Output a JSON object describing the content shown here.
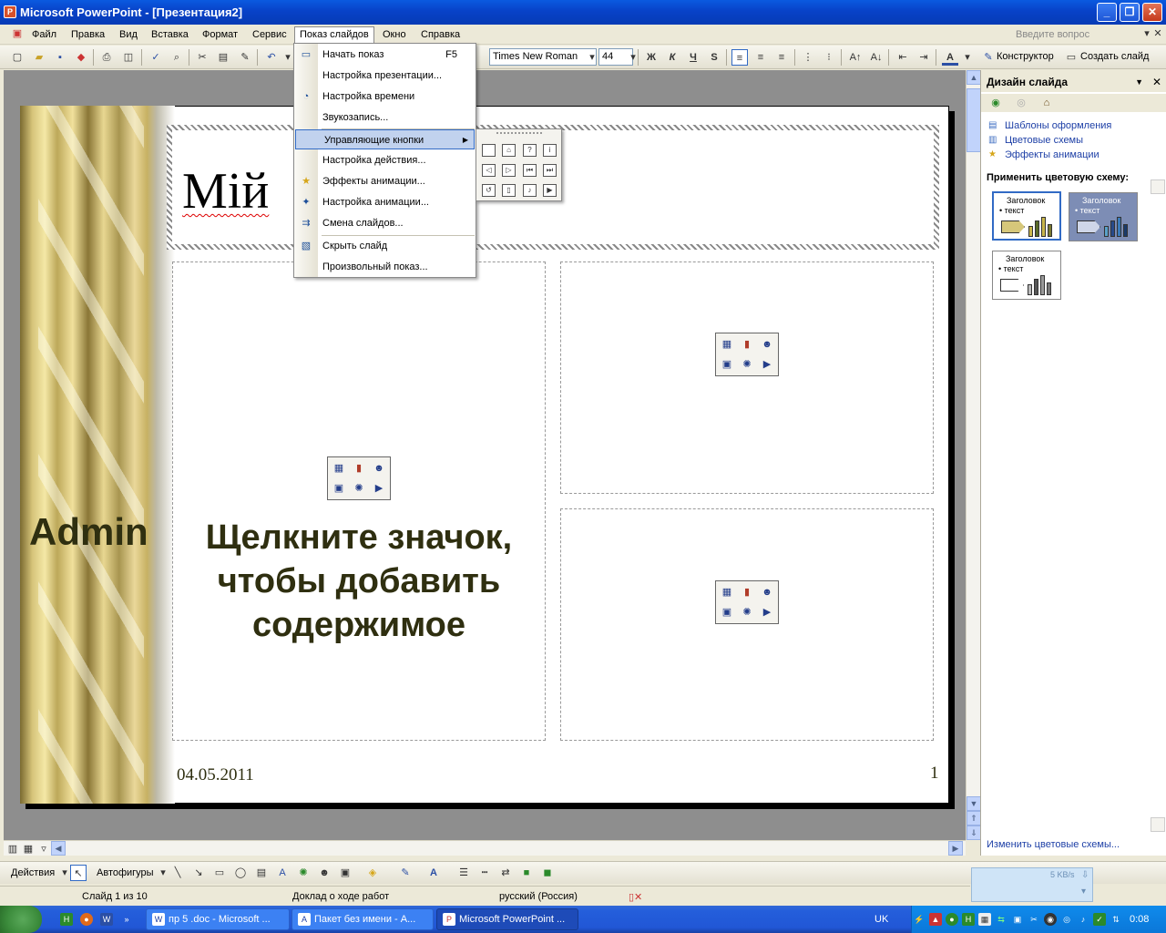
{
  "window": {
    "title": "Microsoft PowerPoint - [Презентация2]",
    "app_icon": "P",
    "minimize": "_",
    "restore": "❐",
    "close": "✕"
  },
  "menubar": {
    "items": [
      "Файл",
      "Правка",
      "Вид",
      "Вставка",
      "Формат",
      "Сервис",
      "Показ слайдов",
      "Окно",
      "Справка"
    ],
    "help_placeholder": "Введите вопрос",
    "doc_close": "✕"
  },
  "toolbar": {
    "font_name": "Times New Roman",
    "font_size": "44",
    "bold": "Ж",
    "italic": "К",
    "underline": "Ч",
    "shadow": "S",
    "designer": "Конструктор",
    "new_slide": "Создать слайд"
  },
  "dropdown": {
    "items": [
      {
        "label": "Начать показ",
        "shortcut": "F5",
        "icon": "projector-icon"
      },
      {
        "label": "Настройка презентации...",
        "shortcut": "",
        "icon": ""
      },
      {
        "label": "Настройка времени",
        "shortcut": "",
        "icon": "timing-icon"
      },
      {
        "label": "Звукозапись...",
        "shortcut": "",
        "icon": ""
      },
      {
        "label": "Управляющие кнопки",
        "shortcut": "",
        "icon": "",
        "submenu": true
      },
      {
        "label": "Настройка действия...",
        "shortcut": "",
        "icon": ""
      },
      {
        "label": "Эффекты анимации...",
        "shortcut": "",
        "icon": "star-icon"
      },
      {
        "label": "Настройка анимации...",
        "shortcut": "",
        "icon": "animation-icon"
      },
      {
        "label": "Смена слайдов...",
        "shortcut": "",
        "icon": "transition-icon"
      },
      {
        "label": "Скрыть слайд",
        "shortcut": "",
        "icon": "hide-slide-icon"
      },
      {
        "label": "Произвольный показ...",
        "shortcut": "",
        "icon": ""
      }
    ]
  },
  "slide": {
    "title": "Мій",
    "side_text": "Admin",
    "placeholder_text": "Щелкните значок, чтобы добавить содержимое",
    "date": "04.05.2011",
    "number": "1"
  },
  "taskpane": {
    "title": "Дизайн слайда",
    "links": [
      "Шаблоны оформления",
      "Цветовые схемы",
      "Эффекты анимации"
    ],
    "apply_label": "Применить цветовую схему:",
    "schemes": [
      {
        "heading": "Заголовок",
        "text": "• текст",
        "bg": "#ffffff",
        "fg": "#000000",
        "accent": "#d6c77a"
      },
      {
        "heading": "Заголовок",
        "text": "• текст",
        "bg": "#7d8db5",
        "fg": "#ffffff",
        "accent": "#cfd6e8"
      },
      {
        "heading": "Заголовок",
        "text": "• текст",
        "bg": "#ffffff",
        "fg": "#000000",
        "accent": "#ffffff"
      }
    ],
    "change_link": "Изменить цветовые схемы..."
  },
  "drawbar": {
    "actions": "Действия",
    "autoshapes": "Автофигуры"
  },
  "statusbar": {
    "slide_info": "Слайд 1 из 10",
    "design": "Доклад о ходе работ",
    "language": "русский (Россия)"
  },
  "network": {
    "speed": "5 KB/s"
  },
  "taskbar": {
    "tasks": [
      {
        "label": "пр 5 .doc - Microsoft ...",
        "icon": "W"
      },
      {
        "label": "Пакет без имени - А...",
        "icon": "A"
      },
      {
        "label": "Microsoft PowerPoint ...",
        "icon": "P"
      }
    ],
    "language": "UK",
    "clock": "0:08"
  }
}
